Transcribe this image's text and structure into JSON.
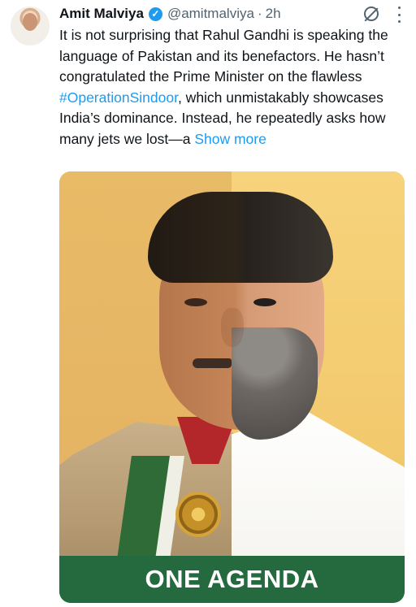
{
  "post": {
    "author_name": "Amit Malviya",
    "handle": "@amitmalviya",
    "separator": "·",
    "time_ago": "2h",
    "text_before_hashtag": "It is not surprising that Rahul Gandhi is speaking the language of Pakistan and its benefactors. He hasn’t congratulated the Prime Minister on the flawless ",
    "hashtag": "#OperationSindoor",
    "text_after_hashtag": ", which unmistakably showcases India’s dominance. Instead, he repeatedly asks how many jets we lost—a ",
    "show_more": "Show more"
  },
  "media": {
    "banner_text": "ONE AGENDA"
  },
  "icons": {
    "verified": "verified-badge-icon",
    "grok": "grok-icon",
    "more": "more-options-icon"
  },
  "colors": {
    "link": "#1d9bf0",
    "muted": "#536471",
    "verified": "#1d9bf0",
    "banner": "#246a3e"
  }
}
